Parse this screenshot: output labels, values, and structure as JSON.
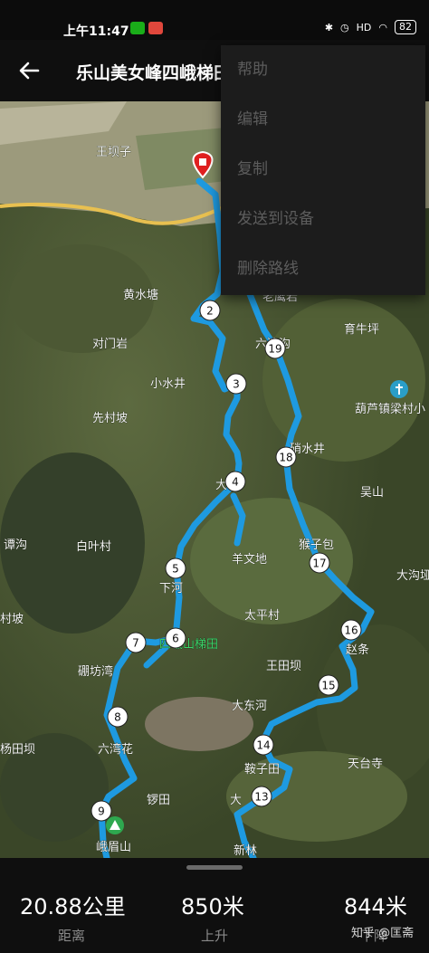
{
  "status_bar": {
    "time": "上午11:47",
    "battery": "82",
    "network": "HD"
  },
  "app_bar": {
    "title": "乐山美女峰四峨梯田"
  },
  "menu": {
    "items": [
      "帮助",
      "编辑",
      "复制",
      "发送到设备",
      "删除路线"
    ]
  },
  "map": {
    "place_labels": [
      "王坝子",
      "黄水塘",
      "对门岩",
      "小水井",
      "先村坡",
      "谭沟",
      "白叶村",
      "村坡",
      "硼坊湾",
      "杨田坝",
      "六湾花",
      "锣田",
      "峨眉山",
      "老鹰岩",
      "六湾沟",
      "育牛坪",
      "葫芦镇梁村小",
      "硝水井",
      "吴山",
      "猴子包",
      "羊文地",
      "大沟垭",
      "太平村",
      "赵条",
      "王田坝",
      "大东河",
      "天台寺",
      "鞍子田",
      "大",
      "新林",
      "下河",
      "大寺",
      "四峨山梯田"
    ],
    "waypoints": [
      "2",
      "3",
      "4",
      "5",
      "6",
      "7",
      "8",
      "9",
      "13",
      "14",
      "15",
      "16",
      "17",
      "18",
      "19"
    ],
    "route_color": "#1e9ae0"
  },
  "stats": {
    "distance_value": "20.88",
    "distance_unit": "公里",
    "distance_label": "距离",
    "ascent_value": "850",
    "ascent_unit": "米",
    "ascent_label": "上升",
    "descent_value": "844",
    "descent_unit": "米",
    "descent_label": "下降"
  },
  "watermark": "知乎 @匡斋"
}
